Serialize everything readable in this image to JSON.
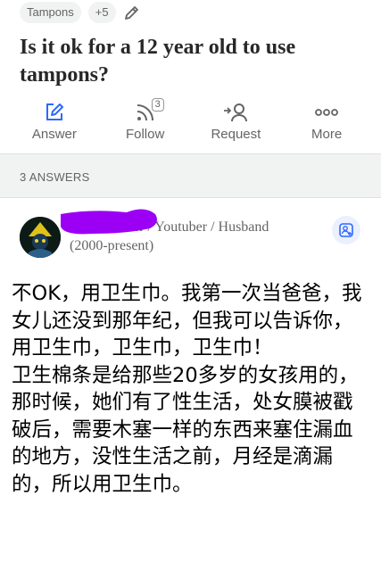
{
  "topics": {
    "first": "Tampons",
    "more": "+5",
    "edit_icon": "pencil-icon"
  },
  "question": {
    "title": "Is it ok for a 12 year old to use tampons?"
  },
  "actions": [
    {
      "label": "Answer",
      "icon": "edit-square-icon"
    },
    {
      "label": "Follow",
      "icon": "rss-icon",
      "count": "3"
    },
    {
      "label": "Request",
      "icon": "request-user-icon"
    },
    {
      "label": "More",
      "icon": "more-dots-icon"
    }
  ],
  "answers_header": "3 ANSWERS",
  "answer": {
    "credential": "Truck Driver / Youtuber / Husband (2000-present)",
    "follow_icon": "add-user-icon",
    "paragraphs": [
      "不OK，用卫生巾。我第一次当爸爸，我女儿还没到那年纪，但我可以告诉你，用卫生巾，卫生巾，卫生巾！",
      "卫生棉条是给那些20多岁的女孩用的，那时候，她们有了性生活，处女膜被戳破后，需要木塞一样的东西来塞住漏血的地方，没性生活之前，月经是滴漏的，所以用卫生巾。"
    ]
  },
  "colors": {
    "accent": "#2e69ff",
    "muted": "#636466",
    "redaction": "#9b00f5",
    "panel": "#f1f2f2"
  }
}
